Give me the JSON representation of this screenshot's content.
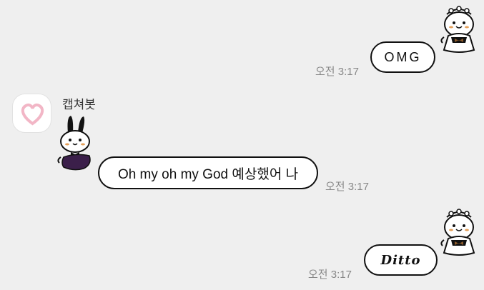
{
  "messages": [
    {
      "direction": "outgoing",
      "text": "OMG",
      "time": "오전 3:17",
      "has_sticker_avatar": true
    },
    {
      "direction": "incoming",
      "sender": "캡쳐봇",
      "text": "Oh my oh my God 예상했어 나",
      "time": "오전 3:17",
      "has_sticker_avatar": true
    },
    {
      "direction": "outgoing",
      "text": "Ditto",
      "time": "오전 3:17",
      "has_sticker_avatar": true
    }
  ],
  "colors": {
    "background": "#efefef",
    "bubble": "#ffffff",
    "bubble_border": "#111111",
    "timestamp": "#888888",
    "profile_heart": "#f2b6c6",
    "maid_bow": "#8b5a2b",
    "bunny_skirt": "#3b1f4a"
  },
  "icons": {
    "profile": "heart-icon",
    "sticker_maid": "maid-sticker-icon",
    "sticker_bunny": "bunny-sticker-icon"
  }
}
